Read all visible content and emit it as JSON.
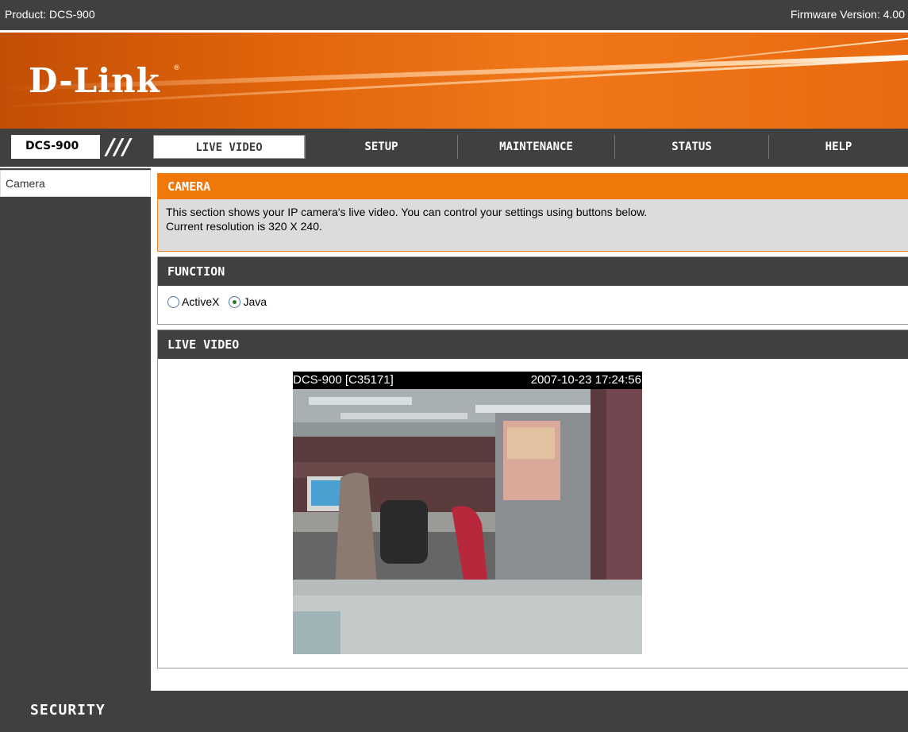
{
  "topbar": {
    "product": "Product: DCS-900",
    "firmware": "Firmware Version: 4.00"
  },
  "banner": {
    "logo": "D-Link",
    "registered": "®"
  },
  "nav": {
    "model": "DCS-900",
    "tabs": [
      {
        "label": "LIVE VIDEO",
        "active": true
      },
      {
        "label": "SETUP",
        "active": false
      },
      {
        "label": "MAINTENANCE",
        "active": false
      },
      {
        "label": "STATUS",
        "active": false
      },
      {
        "label": "HELP",
        "active": false
      }
    ]
  },
  "sidebar": {
    "items": [
      {
        "label": "Camera"
      }
    ]
  },
  "camera_section": {
    "title": "CAMERA",
    "line1": "This section shows your IP camera's live video. You can control your settings using buttons below.",
    "line2": "Current resolution is 320 X 240."
  },
  "function_section": {
    "title": "FUNCTION",
    "options": [
      {
        "label": "ActiveX",
        "checked": false
      },
      {
        "label": "Java",
        "checked": true
      }
    ]
  },
  "live_section": {
    "title": "LIVE VIDEO",
    "camera_label": "DCS-900 [C35171]",
    "timestamp": "2007-10-23 17:24:56"
  },
  "footer": {
    "brand": "SECURITY"
  },
  "colors": {
    "dark": "#404040",
    "orange": "#f07808",
    "gray_panel": "#dcdcdc"
  }
}
